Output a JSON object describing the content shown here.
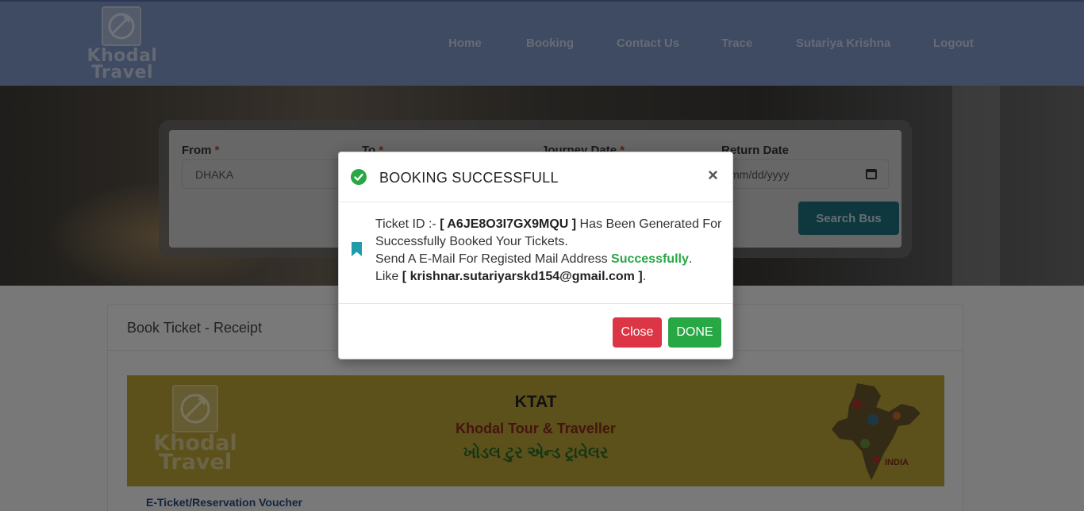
{
  "brand": {
    "logo_text": "Khodal Travel"
  },
  "nav": {
    "items": [
      {
        "label": "Home"
      },
      {
        "label": "Booking"
      },
      {
        "label": "Contact Us"
      },
      {
        "label": "Trace"
      },
      {
        "label": "Sutariya Krishna"
      },
      {
        "label": "Logout"
      }
    ]
  },
  "search": {
    "from_label": "From",
    "to_label": "To",
    "journey_label": "Journey Date",
    "return_label": "Return Date",
    "required_mark": "*",
    "from_value": "DHAKA",
    "return_placeholder": "mm/dd/yyyy",
    "button_label": "Search Bus"
  },
  "receipt": {
    "title": "Book Ticket - Receipt",
    "banner_title": "KTAT",
    "banner_subtitle": "Khodal Tour & Traveller",
    "banner_gujarati": "ખોડલ ટુર એન્ડ ટ્રાવેલર",
    "banner_logo_text": "Khodal Travel",
    "map_label": "INDIA",
    "voucher_label": "E-Ticket/Reservation Voucher"
  },
  "modal": {
    "title": "BOOKING SUCCESSFULL",
    "close_symbol": "×",
    "ticket_prefix": "Ticket ID :- ",
    "ticket_id": "[ A6JE8O3I7GX9MQU ]",
    "line1_suffix": " Has Been Generated For Successfully Booked Your Tickets.",
    "line2_prefix": "Send A E-Mail For Registed Mail Address ",
    "line2_status": "Successfully",
    "line2_suffix": ".",
    "line3_prefix": "Like ",
    "email": "[ krishnar.sutariyarskd154@gmail.com ]",
    "line3_suffix": ".",
    "close_button": "Close",
    "done_button": "DONE"
  },
  "colors": {
    "navbar": "#7e95c6",
    "success": "#28a745",
    "danger": "#dc3545",
    "search_button": "#1f6f7d",
    "banner": "#b8a037"
  },
  "icons": [
    "logo-icon",
    "calendar-icon",
    "check-circle-icon",
    "close-icon",
    "bookmark-icon",
    "india-map-icon"
  ]
}
